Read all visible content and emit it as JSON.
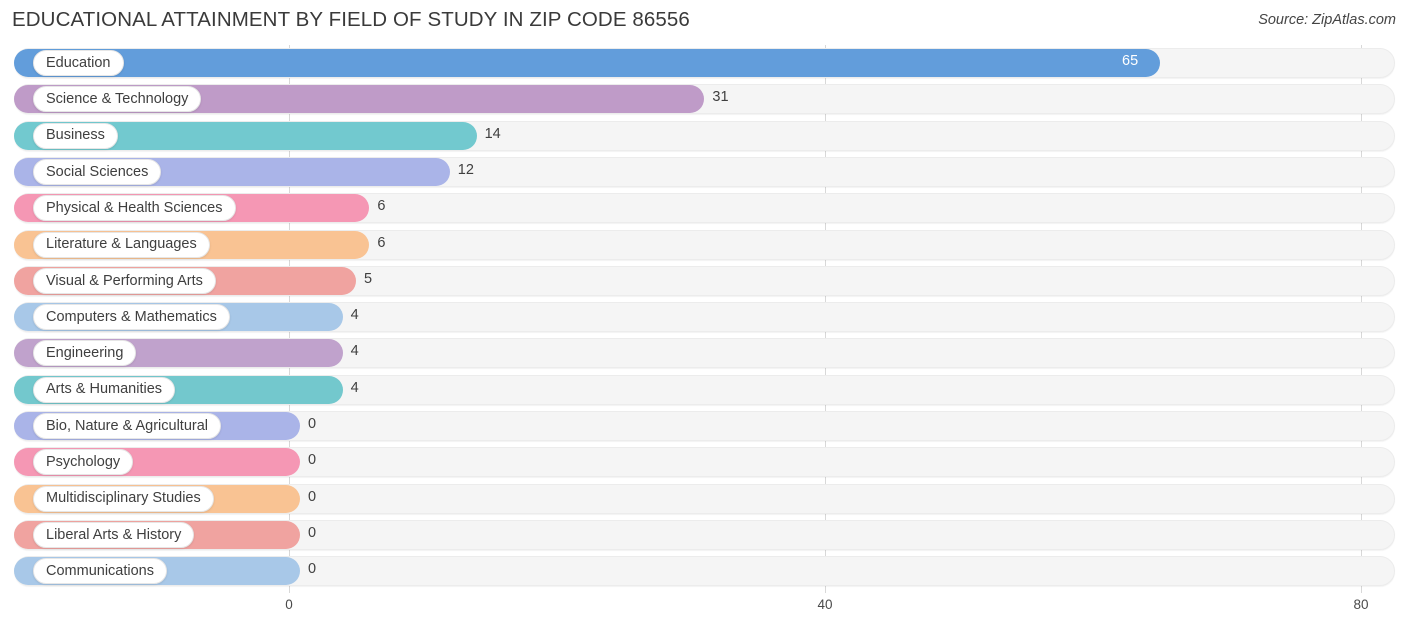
{
  "header": {
    "title": "EDUCATIONAL ATTAINMENT BY FIELD OF STUDY IN ZIP CODE 86556",
    "source": "Source: ZipAtlas.com"
  },
  "chart_data": {
    "type": "bar",
    "orientation": "horizontal",
    "title": "EDUCATIONAL ATTAINMENT BY FIELD OF STUDY IN ZIP CODE 86556",
    "xlabel": "",
    "ylabel": "",
    "xlim": [
      0,
      80
    ],
    "xticks": [
      0,
      40,
      80
    ],
    "xtick_labels": [
      "0",
      "40",
      "80"
    ],
    "grid": true,
    "legend": "none",
    "categories": [
      "Education",
      "Science & Technology",
      "Business",
      "Social Sciences",
      "Physical & Health Sciences",
      "Literature & Languages",
      "Visual & Performing Arts",
      "Computers & Mathematics",
      "Engineering",
      "Arts & Humanities",
      "Bio, Nature & Agricultural",
      "Psychology",
      "Multidisciplinary Studies",
      "Liberal Arts & History",
      "Communications"
    ],
    "values": [
      65,
      31,
      14,
      12,
      6,
      6,
      5,
      4,
      4,
      4,
      0,
      0,
      0,
      0,
      0
    ],
    "value_labels": [
      "65",
      "31",
      "14",
      "12",
      "6",
      "6",
      "5",
      "4",
      "4",
      "4",
      "0",
      "0",
      "0",
      "0",
      "0"
    ],
    "colors": [
      "#629ddb",
      "#bf9bc8",
      "#72c9cf",
      "#aab4e8",
      "#f597b4",
      "#f9c393",
      "#f0a3a0",
      "#a8c8e8",
      "#c0a2cc",
      "#73c8cd",
      "#aab4e8",
      "#f597b4",
      "#f9c393",
      "#f0a3a0",
      "#a8c8e8"
    ],
    "track_color": "#f5f5f5",
    "label_pill_color": "#ffffff"
  }
}
